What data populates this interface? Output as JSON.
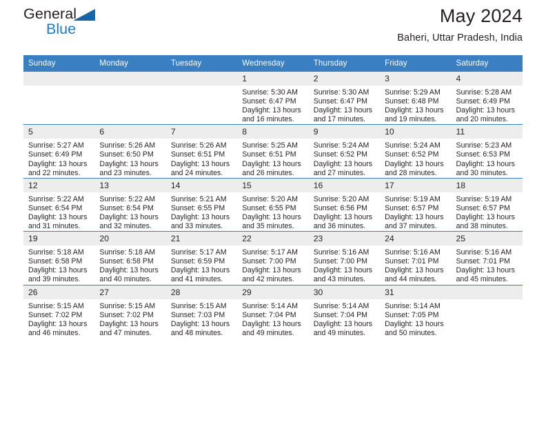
{
  "brand": {
    "name_part1": "General",
    "name_part2": "Blue",
    "flag_icon": "triangle-flag-icon"
  },
  "header": {
    "month_title": "May 2024",
    "location": "Baheri, Uttar Pradesh, India"
  },
  "colors": {
    "header_blue": "#3a7fc1",
    "brand_blue": "#1c7cc4",
    "flag_blue": "#1565a8",
    "daynum_bg": "#ededed",
    "text": "#231f20"
  },
  "weekday_headers": [
    "Sunday",
    "Monday",
    "Tuesday",
    "Wednesday",
    "Thursday",
    "Friday",
    "Saturday"
  ],
  "weeks": [
    [
      {
        "day": "",
        "empty": true
      },
      {
        "day": "",
        "empty": true
      },
      {
        "day": "",
        "empty": true
      },
      {
        "day": "1",
        "sunrise": "Sunrise: 5:30 AM",
        "sunset": "Sunset: 6:47 PM",
        "daylight": "Daylight: 13 hours and 16 minutes."
      },
      {
        "day": "2",
        "sunrise": "Sunrise: 5:30 AM",
        "sunset": "Sunset: 6:47 PM",
        "daylight": "Daylight: 13 hours and 17 minutes."
      },
      {
        "day": "3",
        "sunrise": "Sunrise: 5:29 AM",
        "sunset": "Sunset: 6:48 PM",
        "daylight": "Daylight: 13 hours and 19 minutes."
      },
      {
        "day": "4",
        "sunrise": "Sunrise: 5:28 AM",
        "sunset": "Sunset: 6:49 PM",
        "daylight": "Daylight: 13 hours and 20 minutes."
      }
    ],
    [
      {
        "day": "5",
        "sunrise": "Sunrise: 5:27 AM",
        "sunset": "Sunset: 6:49 PM",
        "daylight": "Daylight: 13 hours and 22 minutes."
      },
      {
        "day": "6",
        "sunrise": "Sunrise: 5:26 AM",
        "sunset": "Sunset: 6:50 PM",
        "daylight": "Daylight: 13 hours and 23 minutes."
      },
      {
        "day": "7",
        "sunrise": "Sunrise: 5:26 AM",
        "sunset": "Sunset: 6:51 PM",
        "daylight": "Daylight: 13 hours and 24 minutes."
      },
      {
        "day": "8",
        "sunrise": "Sunrise: 5:25 AM",
        "sunset": "Sunset: 6:51 PM",
        "daylight": "Daylight: 13 hours and 26 minutes."
      },
      {
        "day": "9",
        "sunrise": "Sunrise: 5:24 AM",
        "sunset": "Sunset: 6:52 PM",
        "daylight": "Daylight: 13 hours and 27 minutes."
      },
      {
        "day": "10",
        "sunrise": "Sunrise: 5:24 AM",
        "sunset": "Sunset: 6:52 PM",
        "daylight": "Daylight: 13 hours and 28 minutes."
      },
      {
        "day": "11",
        "sunrise": "Sunrise: 5:23 AM",
        "sunset": "Sunset: 6:53 PM",
        "daylight": "Daylight: 13 hours and 30 minutes."
      }
    ],
    [
      {
        "day": "12",
        "sunrise": "Sunrise: 5:22 AM",
        "sunset": "Sunset: 6:54 PM",
        "daylight": "Daylight: 13 hours and 31 minutes."
      },
      {
        "day": "13",
        "sunrise": "Sunrise: 5:22 AM",
        "sunset": "Sunset: 6:54 PM",
        "daylight": "Daylight: 13 hours and 32 minutes."
      },
      {
        "day": "14",
        "sunrise": "Sunrise: 5:21 AM",
        "sunset": "Sunset: 6:55 PM",
        "daylight": "Daylight: 13 hours and 33 minutes."
      },
      {
        "day": "15",
        "sunrise": "Sunrise: 5:20 AM",
        "sunset": "Sunset: 6:55 PM",
        "daylight": "Daylight: 13 hours and 35 minutes."
      },
      {
        "day": "16",
        "sunrise": "Sunrise: 5:20 AM",
        "sunset": "Sunset: 6:56 PM",
        "daylight": "Daylight: 13 hours and 36 minutes."
      },
      {
        "day": "17",
        "sunrise": "Sunrise: 5:19 AM",
        "sunset": "Sunset: 6:57 PM",
        "daylight": "Daylight: 13 hours and 37 minutes."
      },
      {
        "day": "18",
        "sunrise": "Sunrise: 5:19 AM",
        "sunset": "Sunset: 6:57 PM",
        "daylight": "Daylight: 13 hours and 38 minutes."
      }
    ],
    [
      {
        "day": "19",
        "sunrise": "Sunrise: 5:18 AM",
        "sunset": "Sunset: 6:58 PM",
        "daylight": "Daylight: 13 hours and 39 minutes."
      },
      {
        "day": "20",
        "sunrise": "Sunrise: 5:18 AM",
        "sunset": "Sunset: 6:58 PM",
        "daylight": "Daylight: 13 hours and 40 minutes."
      },
      {
        "day": "21",
        "sunrise": "Sunrise: 5:17 AM",
        "sunset": "Sunset: 6:59 PM",
        "daylight": "Daylight: 13 hours and 41 minutes."
      },
      {
        "day": "22",
        "sunrise": "Sunrise: 5:17 AM",
        "sunset": "Sunset: 7:00 PM",
        "daylight": "Daylight: 13 hours and 42 minutes."
      },
      {
        "day": "23",
        "sunrise": "Sunrise: 5:16 AM",
        "sunset": "Sunset: 7:00 PM",
        "daylight": "Daylight: 13 hours and 43 minutes."
      },
      {
        "day": "24",
        "sunrise": "Sunrise: 5:16 AM",
        "sunset": "Sunset: 7:01 PM",
        "daylight": "Daylight: 13 hours and 44 minutes."
      },
      {
        "day": "25",
        "sunrise": "Sunrise: 5:16 AM",
        "sunset": "Sunset: 7:01 PM",
        "daylight": "Daylight: 13 hours and 45 minutes."
      }
    ],
    [
      {
        "day": "26",
        "sunrise": "Sunrise: 5:15 AM",
        "sunset": "Sunset: 7:02 PM",
        "daylight": "Daylight: 13 hours and 46 minutes."
      },
      {
        "day": "27",
        "sunrise": "Sunrise: 5:15 AM",
        "sunset": "Sunset: 7:02 PM",
        "daylight": "Daylight: 13 hours and 47 minutes."
      },
      {
        "day": "28",
        "sunrise": "Sunrise: 5:15 AM",
        "sunset": "Sunset: 7:03 PM",
        "daylight": "Daylight: 13 hours and 48 minutes."
      },
      {
        "day": "29",
        "sunrise": "Sunrise: 5:14 AM",
        "sunset": "Sunset: 7:04 PM",
        "daylight": "Daylight: 13 hours and 49 minutes."
      },
      {
        "day": "30",
        "sunrise": "Sunrise: 5:14 AM",
        "sunset": "Sunset: 7:04 PM",
        "daylight": "Daylight: 13 hours and 49 minutes."
      },
      {
        "day": "31",
        "sunrise": "Sunrise: 5:14 AM",
        "sunset": "Sunset: 7:05 PM",
        "daylight": "Daylight: 13 hours and 50 minutes."
      },
      {
        "day": "",
        "empty": true
      }
    ]
  ]
}
